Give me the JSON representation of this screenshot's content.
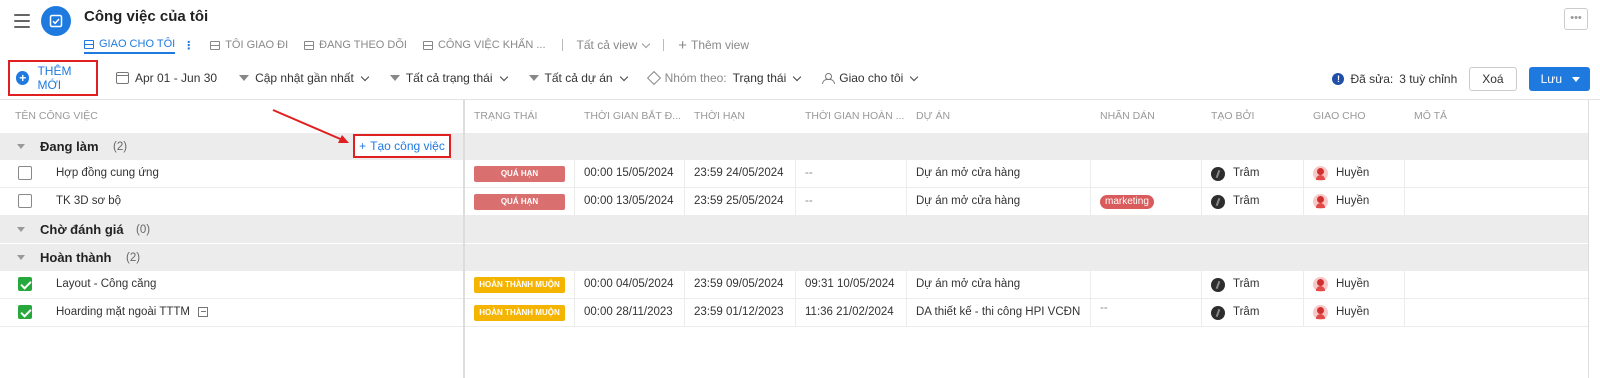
{
  "header": {
    "title": "Công việc của tôi",
    "tabs": [
      {
        "label": "GIAO CHO TÔI",
        "active": true
      },
      {
        "label": "TÔI GIAO ĐI",
        "active": false
      },
      {
        "label": "ĐANG THEO DÕI",
        "active": false
      },
      {
        "label": "CÔNG VIỆC KHẨN ...",
        "active": false
      }
    ],
    "all_views": "Tất cả view",
    "add_view": "Thêm view",
    "more": "•••"
  },
  "toolbar": {
    "add_new": "THÊM MỚI",
    "date_range": "Apr 01 - Jun 30",
    "sort": "Cập nhật gần nhất",
    "status_filter": "Tất cả trạng thái",
    "project_filter": "Tất cả dự án",
    "group_by_label": "Nhóm theo:",
    "group_by_value": "Trạng thái",
    "assignee_filter": "Giao cho tôi",
    "edited_label": "Đã sửa:",
    "edited_value": "3 tuỳ chỉnh",
    "cancel": "Xoá",
    "save": "Lưu"
  },
  "columns": {
    "name": "TÊN CÔNG VIỆC",
    "status": "TRẠNG THÁI",
    "start": "THỜI GIAN BẮT Đ...",
    "deadline": "THỜI HẠN",
    "completed": "THỜI GIAN HOÀN ...",
    "project": "DỰ ÁN",
    "label": "NHÃN DÁN",
    "creator": "TẠO BỞI",
    "assignee": "GIAO CHO",
    "description": "MÔ TẢ"
  },
  "create_task": "Tạo công việc",
  "groups": [
    {
      "name": "Đang làm",
      "count": "(2)",
      "tasks": [
        {
          "name": "Hợp đồng cung ứng",
          "checked": false,
          "status": "QUÁ HẠN",
          "start": "00:00 15/05/2024",
          "deadline": "23:59 24/05/2024",
          "completed": "--",
          "project": "Dự án mở cửa hàng",
          "label": "",
          "creator": "Trâm",
          "assignee": "Huyền"
        },
        {
          "name": "TK 3D sơ bộ",
          "checked": false,
          "status": "QUÁ HẠN",
          "start": "00:00 13/05/2024",
          "deadline": "23:59 25/05/2024",
          "completed": "--",
          "project": "Dự án mở cửa hàng",
          "label": "marketing",
          "creator": "Trâm",
          "assignee": "Huyền"
        }
      ]
    },
    {
      "name": "Chờ đánh giá",
      "count": "(0)",
      "tasks": []
    },
    {
      "name": "Hoàn thành",
      "count": "(2)",
      "tasks": [
        {
          "name": "Layout - Công căng",
          "checked": true,
          "status": "HOÀN THÀNH MUỘN",
          "start": "00:00 04/05/2024",
          "deadline": "23:59 09/05/2024",
          "completed": "09:31 10/05/2024",
          "project": "Dự án mở cửa hàng",
          "label": "",
          "creator": "Trâm",
          "assignee": "Huyền"
        },
        {
          "name": "Hoarding mặt ngoài TTTM",
          "checked": true,
          "status": "HOÀN THÀNH MUỘN",
          "start": "00:00 28/11/2023",
          "deadline": "23:59 01/12/2023",
          "completed": "11:36 21/02/2024",
          "project": "DA thiết kế - thi công HPI VCĐN",
          "label": "--",
          "creator": "Trâm",
          "assignee": "Huyền"
        }
      ]
    }
  ],
  "colors": {
    "accent": "#1f7ae0",
    "late": "#d9706f",
    "done_late": "#f5b400",
    "highlight": "#e02020",
    "tag": "#d95b5b"
  }
}
